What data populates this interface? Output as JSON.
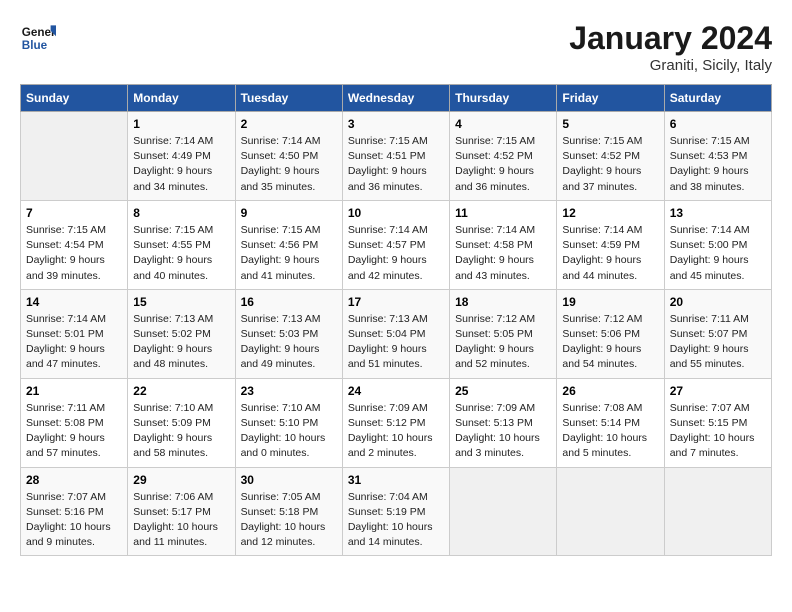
{
  "header": {
    "logo_line1": "General",
    "logo_line2": "Blue",
    "title": "January 2024",
    "subtitle": "Graniti, Sicily, Italy"
  },
  "days_of_week": [
    "Sunday",
    "Monday",
    "Tuesday",
    "Wednesday",
    "Thursday",
    "Friday",
    "Saturday"
  ],
  "weeks": [
    [
      {
        "date": "",
        "info": ""
      },
      {
        "date": "1",
        "info": "Sunrise: 7:14 AM\nSunset: 4:49 PM\nDaylight: 9 hours\nand 34 minutes."
      },
      {
        "date": "2",
        "info": "Sunrise: 7:14 AM\nSunset: 4:50 PM\nDaylight: 9 hours\nand 35 minutes."
      },
      {
        "date": "3",
        "info": "Sunrise: 7:15 AM\nSunset: 4:51 PM\nDaylight: 9 hours\nand 36 minutes."
      },
      {
        "date": "4",
        "info": "Sunrise: 7:15 AM\nSunset: 4:52 PM\nDaylight: 9 hours\nand 36 minutes."
      },
      {
        "date": "5",
        "info": "Sunrise: 7:15 AM\nSunset: 4:52 PM\nDaylight: 9 hours\nand 37 minutes."
      },
      {
        "date": "6",
        "info": "Sunrise: 7:15 AM\nSunset: 4:53 PM\nDaylight: 9 hours\nand 38 minutes."
      }
    ],
    [
      {
        "date": "7",
        "info": "Sunrise: 7:15 AM\nSunset: 4:54 PM\nDaylight: 9 hours\nand 39 minutes."
      },
      {
        "date": "8",
        "info": "Sunrise: 7:15 AM\nSunset: 4:55 PM\nDaylight: 9 hours\nand 40 minutes."
      },
      {
        "date": "9",
        "info": "Sunrise: 7:15 AM\nSunset: 4:56 PM\nDaylight: 9 hours\nand 41 minutes."
      },
      {
        "date": "10",
        "info": "Sunrise: 7:14 AM\nSunset: 4:57 PM\nDaylight: 9 hours\nand 42 minutes."
      },
      {
        "date": "11",
        "info": "Sunrise: 7:14 AM\nSunset: 4:58 PM\nDaylight: 9 hours\nand 43 minutes."
      },
      {
        "date": "12",
        "info": "Sunrise: 7:14 AM\nSunset: 4:59 PM\nDaylight: 9 hours\nand 44 minutes."
      },
      {
        "date": "13",
        "info": "Sunrise: 7:14 AM\nSunset: 5:00 PM\nDaylight: 9 hours\nand 45 minutes."
      }
    ],
    [
      {
        "date": "14",
        "info": "Sunrise: 7:14 AM\nSunset: 5:01 PM\nDaylight: 9 hours\nand 47 minutes."
      },
      {
        "date": "15",
        "info": "Sunrise: 7:13 AM\nSunset: 5:02 PM\nDaylight: 9 hours\nand 48 minutes."
      },
      {
        "date": "16",
        "info": "Sunrise: 7:13 AM\nSunset: 5:03 PM\nDaylight: 9 hours\nand 49 minutes."
      },
      {
        "date": "17",
        "info": "Sunrise: 7:13 AM\nSunset: 5:04 PM\nDaylight: 9 hours\nand 51 minutes."
      },
      {
        "date": "18",
        "info": "Sunrise: 7:12 AM\nSunset: 5:05 PM\nDaylight: 9 hours\nand 52 minutes."
      },
      {
        "date": "19",
        "info": "Sunrise: 7:12 AM\nSunset: 5:06 PM\nDaylight: 9 hours\nand 54 minutes."
      },
      {
        "date": "20",
        "info": "Sunrise: 7:11 AM\nSunset: 5:07 PM\nDaylight: 9 hours\nand 55 minutes."
      }
    ],
    [
      {
        "date": "21",
        "info": "Sunrise: 7:11 AM\nSunset: 5:08 PM\nDaylight: 9 hours\nand 57 minutes."
      },
      {
        "date": "22",
        "info": "Sunrise: 7:10 AM\nSunset: 5:09 PM\nDaylight: 9 hours\nand 58 minutes."
      },
      {
        "date": "23",
        "info": "Sunrise: 7:10 AM\nSunset: 5:10 PM\nDaylight: 10 hours\nand 0 minutes."
      },
      {
        "date": "24",
        "info": "Sunrise: 7:09 AM\nSunset: 5:12 PM\nDaylight: 10 hours\nand 2 minutes."
      },
      {
        "date": "25",
        "info": "Sunrise: 7:09 AM\nSunset: 5:13 PM\nDaylight: 10 hours\nand 3 minutes."
      },
      {
        "date": "26",
        "info": "Sunrise: 7:08 AM\nSunset: 5:14 PM\nDaylight: 10 hours\nand 5 minutes."
      },
      {
        "date": "27",
        "info": "Sunrise: 7:07 AM\nSunset: 5:15 PM\nDaylight: 10 hours\nand 7 minutes."
      }
    ],
    [
      {
        "date": "28",
        "info": "Sunrise: 7:07 AM\nSunset: 5:16 PM\nDaylight: 10 hours\nand 9 minutes."
      },
      {
        "date": "29",
        "info": "Sunrise: 7:06 AM\nSunset: 5:17 PM\nDaylight: 10 hours\nand 11 minutes."
      },
      {
        "date": "30",
        "info": "Sunrise: 7:05 AM\nSunset: 5:18 PM\nDaylight: 10 hours\nand 12 minutes."
      },
      {
        "date": "31",
        "info": "Sunrise: 7:04 AM\nSunset: 5:19 PM\nDaylight: 10 hours\nand 14 minutes."
      },
      {
        "date": "",
        "info": ""
      },
      {
        "date": "",
        "info": ""
      },
      {
        "date": "",
        "info": ""
      }
    ]
  ]
}
